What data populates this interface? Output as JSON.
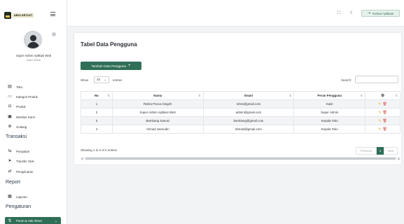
{
  "brand": {
    "name": "ABOI ARTLET"
  },
  "profile": {
    "name": "Super Admin Aplikasi Web",
    "role": "Super Admin"
  },
  "sidebar": {
    "items": [
      {
        "label": "Toko",
        "icon": "store-icon"
      },
      {
        "label": "Kategori Produk",
        "icon": "folder-icon"
      },
      {
        "label": "Produk",
        "icon": "box-icon"
      },
      {
        "label": "Member Kami",
        "icon": "id-card-icon"
      },
      {
        "label": "Gudang",
        "icon": "warehouse-icon"
      }
    ],
    "section_transaksi": "Transaksi",
    "transaksi_items": [
      {
        "label": "Penjualan",
        "icon": "exchange-icon"
      },
      {
        "label": "Transfer Stok",
        "icon": "send-icon"
      },
      {
        "label": "Pengeluaran",
        "icon": "outflow-icon"
      }
    ],
    "section_report": "Report",
    "report_items": [
      {
        "label": "Laporan",
        "icon": "report-icon"
      }
    ],
    "section_pengaturan": "Pengaturan",
    "pengaturan_items": [
      {
        "label": "Peran & Hak Akses",
        "icon": "roles-icon"
      }
    ]
  },
  "topbar": {
    "logout_label": "Keluar Aplikasi"
  },
  "card": {
    "title": "Tabel Data Pengguna",
    "add_button": "Tambah Data Pengguna",
    "show_label": "Show",
    "entries_value": "10",
    "entries_label": "entries",
    "search_label": "Search:",
    "search_value": ""
  },
  "table": {
    "headers": [
      "No",
      "Nama",
      "Email",
      "Peran Pengguna"
    ],
    "rows": [
      {
        "no": "1",
        "nama": "Rahra Poeca Singeh",
        "email": "rahra@gmail.com",
        "peran": "Kasir"
      },
      {
        "no": "2",
        "nama": "Super Admin Aplikasi Web",
        "email": "admin@gmail.com",
        "peran": "Super Admin"
      },
      {
        "no": "3",
        "nama": "Bambang Sanusi",
        "email": "bambang@gmail.com",
        "peran": "Kepala Toko"
      },
      {
        "no": "4",
        "nama": "Ahmad Jaenudin",
        "email": "ahmad@gmail.com",
        "peran": "Kepala Toko"
      }
    ]
  },
  "footer": {
    "info": "Showing 1 to 4 of 4 entries",
    "prev": "Previous",
    "page": "1",
    "next": "Next"
  },
  "colors": {
    "primary": "#2f6f57",
    "edit": "#e0a800",
    "delete": "#d9534f"
  }
}
